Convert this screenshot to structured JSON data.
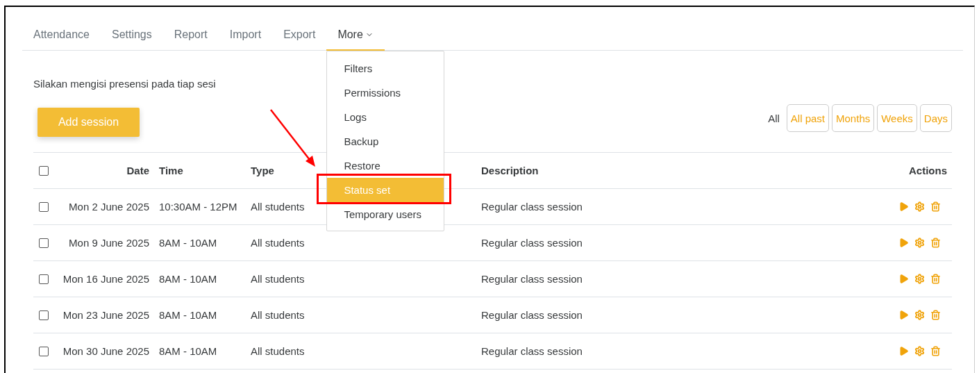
{
  "tabs": [
    {
      "label": "Attendance",
      "selected": false
    },
    {
      "label": "Settings",
      "selected": false
    },
    {
      "label": "Report",
      "selected": false
    },
    {
      "label": "Import",
      "selected": false
    },
    {
      "label": "Export",
      "selected": false
    },
    {
      "label": "More",
      "selected": true,
      "expanded": true
    }
  ],
  "more_menu": [
    {
      "label": "Filters",
      "selected": false
    },
    {
      "label": "Permissions",
      "selected": false
    },
    {
      "label": "Logs",
      "selected": false
    },
    {
      "label": "Backup",
      "selected": false
    },
    {
      "label": "Restore",
      "selected": false
    },
    {
      "label": "Status set",
      "selected": true
    },
    {
      "label": "Temporary users",
      "selected": false
    }
  ],
  "intro": "Silakan mengisi presensi pada tiap sesi",
  "add_button": "Add session",
  "view_filters": [
    {
      "label": "All",
      "selected": true
    },
    {
      "label": "All past",
      "selected": false
    },
    {
      "label": "Months",
      "selected": false
    },
    {
      "label": "Weeks",
      "selected": false
    },
    {
      "label": "Days",
      "selected": false
    }
  ],
  "table": {
    "select_all": {
      "checked": false
    },
    "columns": [
      "Date",
      "Time",
      "Type",
      "Description",
      "Actions"
    ],
    "rows": [
      {
        "checked": false,
        "date": "Mon 2 June 2025",
        "time": "10:30AM - 12PM",
        "type": "All students",
        "description": "Regular class session"
      },
      {
        "checked": false,
        "date": "Mon 9 June 2025",
        "time": "8AM - 10AM",
        "type": "All students",
        "description": "Regular class session"
      },
      {
        "checked": false,
        "date": "Mon 16 June 2025",
        "time": "8AM - 10AM",
        "type": "All students",
        "description": "Regular class session"
      },
      {
        "checked": false,
        "date": "Mon 23 June 2025",
        "time": "8AM - 10AM",
        "type": "All students",
        "description": "Regular class session"
      },
      {
        "checked": false,
        "date": "Mon 30 June 2025",
        "time": "8AM - 10AM",
        "type": "All students",
        "description": "Regular class session"
      }
    ]
  }
}
